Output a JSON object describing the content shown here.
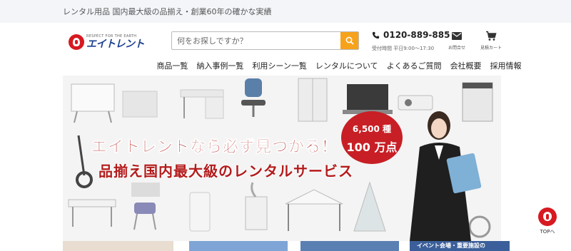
{
  "topbar": {
    "text": "レンタル用品 国内最大級の品揃え・創業60年の確かな実績"
  },
  "logo": {
    "tagline": "RESPECT FOR THE EARTH",
    "name": "エイトレント"
  },
  "search": {
    "placeholder": "何をお探しですか？"
  },
  "phone": {
    "number": "0120-889-885",
    "hours": "受付時間 平日9:00〜17:30"
  },
  "util": {
    "contact_label": "お問合せ",
    "cart_label": "見積カート"
  },
  "nav": {
    "items": [
      {
        "label": "商品一覧"
      },
      {
        "label": "納入事例一覧"
      },
      {
        "label": "利用シーン一覧"
      },
      {
        "label": "レンタルについて"
      },
      {
        "label": "よくあるご質問"
      },
      {
        "label": "会社概要"
      },
      {
        "label": "採用情報"
      }
    ]
  },
  "hero": {
    "headline1": "エイトレントなら必ず見つかる！",
    "headline2": "品揃え国内最大級のレンタルサービス",
    "badge_line1": "6,500 種",
    "badge_line2": "100 万点"
  },
  "pagetop": {
    "label": "TOPへ"
  },
  "cards": {
    "card4_text": "イベント会場・重要施設の"
  },
  "colors": {
    "accent": "#f7a21b",
    "brand_red": "#d71920",
    "logo_blue": "#1a3f8f"
  }
}
